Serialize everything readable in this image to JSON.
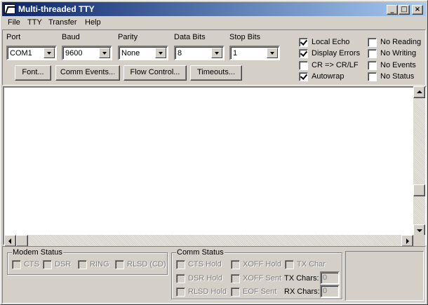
{
  "window": {
    "title": "Multi-threaded TTY"
  },
  "caption_buttons": {
    "minimize": "_",
    "maximize": "□",
    "close": "×"
  },
  "menu": [
    "File",
    "TTY",
    "Transfer",
    "Help"
  ],
  "settings": {
    "port": {
      "label": "Port",
      "value": "COM1"
    },
    "baud": {
      "label": "Baud",
      "value": "9600"
    },
    "parity": {
      "label": "Parity",
      "value": "None"
    },
    "data_bits": {
      "label": "Data Bits",
      "value": "8"
    },
    "stop_bits": {
      "label": "Stop Bits",
      "value": "1"
    }
  },
  "buttons": [
    "Font...",
    "Comm Events...",
    "Flow Control...",
    "Timeouts..."
  ],
  "options_left": [
    {
      "label": "Local Echo",
      "checked": true
    },
    {
      "label": "Display Errors",
      "checked": true
    },
    {
      "label": "CR => CR/LF",
      "checked": false
    },
    {
      "label": "Autowrap",
      "checked": true
    }
  ],
  "options_right": [
    {
      "label": "No Reading",
      "checked": false
    },
    {
      "label": "No Writing",
      "checked": false
    },
    {
      "label": "No Events",
      "checked": false
    },
    {
      "label": "No Status",
      "checked": false
    }
  ],
  "modem_status": {
    "title": "Modem Status",
    "items": [
      "CTS",
      "DSR",
      "RING",
      "RLSD (CD)"
    ]
  },
  "comm_status": {
    "title": "Comm Status",
    "cts_hold": "CTS Hold",
    "xoff_hold": "XOFF Hold",
    "tx_char": "TX Char",
    "dsr_hold": "DSR Hold",
    "xoff_sent": "XOFF Sent",
    "rlsd_hold": "RLSD Hold",
    "eof_sent": "EOF Sent",
    "tx_chars_label": "TX Chars:",
    "tx_chars_value": "0",
    "rx_chars_label": "RX Chars:",
    "rx_chars_value": "0"
  }
}
